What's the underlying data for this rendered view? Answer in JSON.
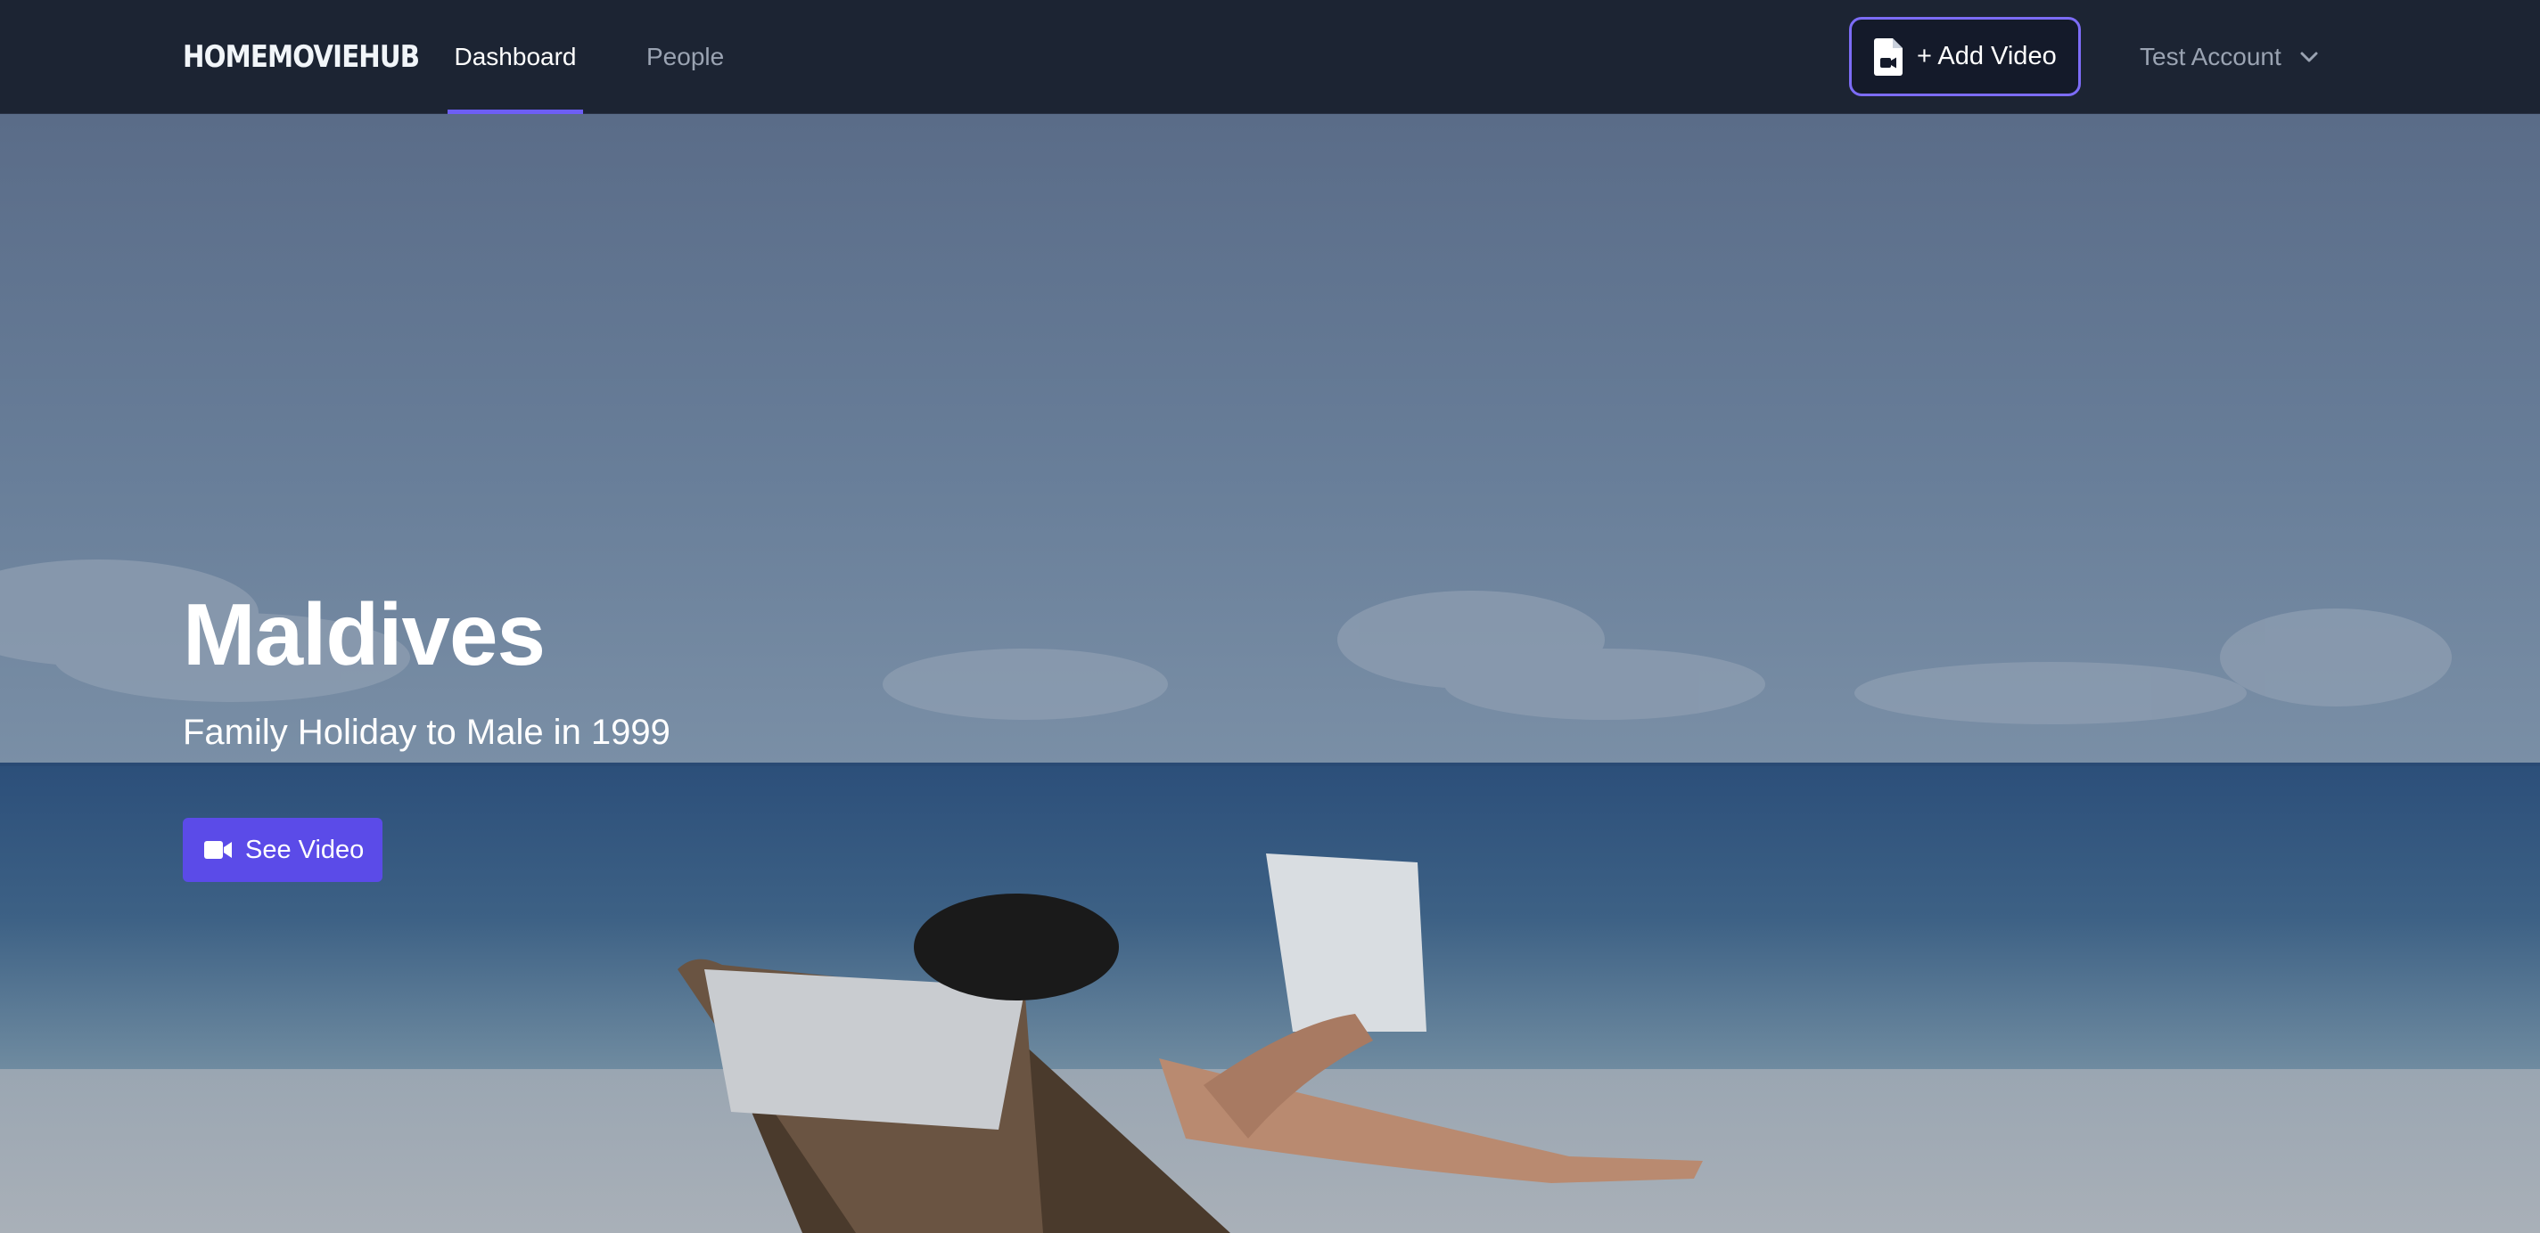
{
  "brand": {
    "name": "HOMEMOVIEHUB"
  },
  "nav": {
    "tabs": [
      {
        "label": "Dashboard",
        "active": true
      },
      {
        "label": "People",
        "active": false
      }
    ]
  },
  "header": {
    "add_video_label": "+ Add Video",
    "add_video_icon": "file-video-icon",
    "account_label": "Test Account",
    "account_icon": "chevron-down-icon"
  },
  "hero": {
    "title": "Maldives",
    "subtitle": "Family Holiday to Male in 1999",
    "button_label": "See Video",
    "button_icon": "video-camera-icon",
    "background": "beach-photo"
  },
  "colors": {
    "navbar_bg": "#1c2433",
    "accent": "#5b4be8",
    "accent_border": "#7c6cf6",
    "nav_inactive": "#9aa3b2"
  }
}
